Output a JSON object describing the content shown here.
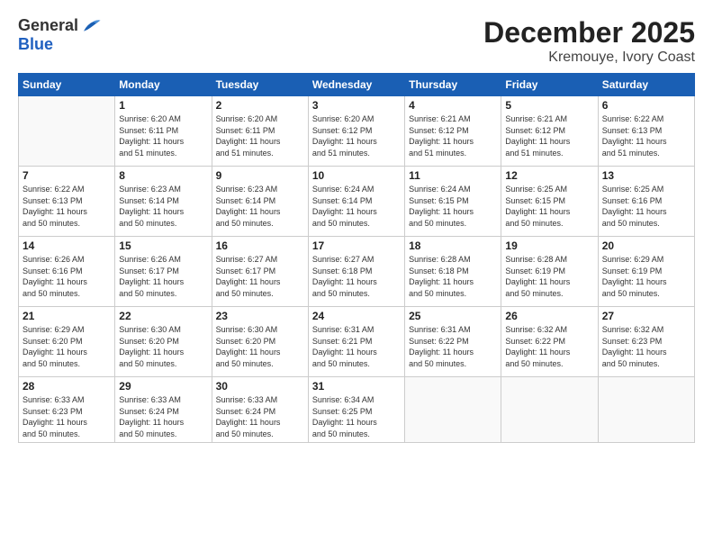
{
  "logo": {
    "general": "General",
    "blue": "Blue"
  },
  "header": {
    "month": "December 2025",
    "location": "Kremouye, Ivory Coast"
  },
  "weekdays": [
    "Sunday",
    "Monday",
    "Tuesday",
    "Wednesday",
    "Thursday",
    "Friday",
    "Saturday"
  ],
  "rows": [
    [
      {
        "day": "",
        "info": ""
      },
      {
        "day": "1",
        "info": "Sunrise: 6:20 AM\nSunset: 6:11 PM\nDaylight: 11 hours\nand 51 minutes."
      },
      {
        "day": "2",
        "info": "Sunrise: 6:20 AM\nSunset: 6:11 PM\nDaylight: 11 hours\nand 51 minutes."
      },
      {
        "day": "3",
        "info": "Sunrise: 6:20 AM\nSunset: 6:12 PM\nDaylight: 11 hours\nand 51 minutes."
      },
      {
        "day": "4",
        "info": "Sunrise: 6:21 AM\nSunset: 6:12 PM\nDaylight: 11 hours\nand 51 minutes."
      },
      {
        "day": "5",
        "info": "Sunrise: 6:21 AM\nSunset: 6:12 PM\nDaylight: 11 hours\nand 51 minutes."
      },
      {
        "day": "6",
        "info": "Sunrise: 6:22 AM\nSunset: 6:13 PM\nDaylight: 11 hours\nand 51 minutes."
      }
    ],
    [
      {
        "day": "7",
        "info": "Sunrise: 6:22 AM\nSunset: 6:13 PM\nDaylight: 11 hours\nand 50 minutes."
      },
      {
        "day": "8",
        "info": "Sunrise: 6:23 AM\nSunset: 6:14 PM\nDaylight: 11 hours\nand 50 minutes."
      },
      {
        "day": "9",
        "info": "Sunrise: 6:23 AM\nSunset: 6:14 PM\nDaylight: 11 hours\nand 50 minutes."
      },
      {
        "day": "10",
        "info": "Sunrise: 6:24 AM\nSunset: 6:14 PM\nDaylight: 11 hours\nand 50 minutes."
      },
      {
        "day": "11",
        "info": "Sunrise: 6:24 AM\nSunset: 6:15 PM\nDaylight: 11 hours\nand 50 minutes."
      },
      {
        "day": "12",
        "info": "Sunrise: 6:25 AM\nSunset: 6:15 PM\nDaylight: 11 hours\nand 50 minutes."
      },
      {
        "day": "13",
        "info": "Sunrise: 6:25 AM\nSunset: 6:16 PM\nDaylight: 11 hours\nand 50 minutes."
      }
    ],
    [
      {
        "day": "14",
        "info": "Sunrise: 6:26 AM\nSunset: 6:16 PM\nDaylight: 11 hours\nand 50 minutes."
      },
      {
        "day": "15",
        "info": "Sunrise: 6:26 AM\nSunset: 6:17 PM\nDaylight: 11 hours\nand 50 minutes."
      },
      {
        "day": "16",
        "info": "Sunrise: 6:27 AM\nSunset: 6:17 PM\nDaylight: 11 hours\nand 50 minutes."
      },
      {
        "day": "17",
        "info": "Sunrise: 6:27 AM\nSunset: 6:18 PM\nDaylight: 11 hours\nand 50 minutes."
      },
      {
        "day": "18",
        "info": "Sunrise: 6:28 AM\nSunset: 6:18 PM\nDaylight: 11 hours\nand 50 minutes."
      },
      {
        "day": "19",
        "info": "Sunrise: 6:28 AM\nSunset: 6:19 PM\nDaylight: 11 hours\nand 50 minutes."
      },
      {
        "day": "20",
        "info": "Sunrise: 6:29 AM\nSunset: 6:19 PM\nDaylight: 11 hours\nand 50 minutes."
      }
    ],
    [
      {
        "day": "21",
        "info": "Sunrise: 6:29 AM\nSunset: 6:20 PM\nDaylight: 11 hours\nand 50 minutes."
      },
      {
        "day": "22",
        "info": "Sunrise: 6:30 AM\nSunset: 6:20 PM\nDaylight: 11 hours\nand 50 minutes."
      },
      {
        "day": "23",
        "info": "Sunrise: 6:30 AM\nSunset: 6:20 PM\nDaylight: 11 hours\nand 50 minutes."
      },
      {
        "day": "24",
        "info": "Sunrise: 6:31 AM\nSunset: 6:21 PM\nDaylight: 11 hours\nand 50 minutes."
      },
      {
        "day": "25",
        "info": "Sunrise: 6:31 AM\nSunset: 6:22 PM\nDaylight: 11 hours\nand 50 minutes."
      },
      {
        "day": "26",
        "info": "Sunrise: 6:32 AM\nSunset: 6:22 PM\nDaylight: 11 hours\nand 50 minutes."
      },
      {
        "day": "27",
        "info": "Sunrise: 6:32 AM\nSunset: 6:23 PM\nDaylight: 11 hours\nand 50 minutes."
      }
    ],
    [
      {
        "day": "28",
        "info": "Sunrise: 6:33 AM\nSunset: 6:23 PM\nDaylight: 11 hours\nand 50 minutes."
      },
      {
        "day": "29",
        "info": "Sunrise: 6:33 AM\nSunset: 6:24 PM\nDaylight: 11 hours\nand 50 minutes."
      },
      {
        "day": "30",
        "info": "Sunrise: 6:33 AM\nSunset: 6:24 PM\nDaylight: 11 hours\nand 50 minutes."
      },
      {
        "day": "31",
        "info": "Sunrise: 6:34 AM\nSunset: 6:25 PM\nDaylight: 11 hours\nand 50 minutes."
      },
      {
        "day": "",
        "info": ""
      },
      {
        "day": "",
        "info": ""
      },
      {
        "day": "",
        "info": ""
      }
    ]
  ]
}
